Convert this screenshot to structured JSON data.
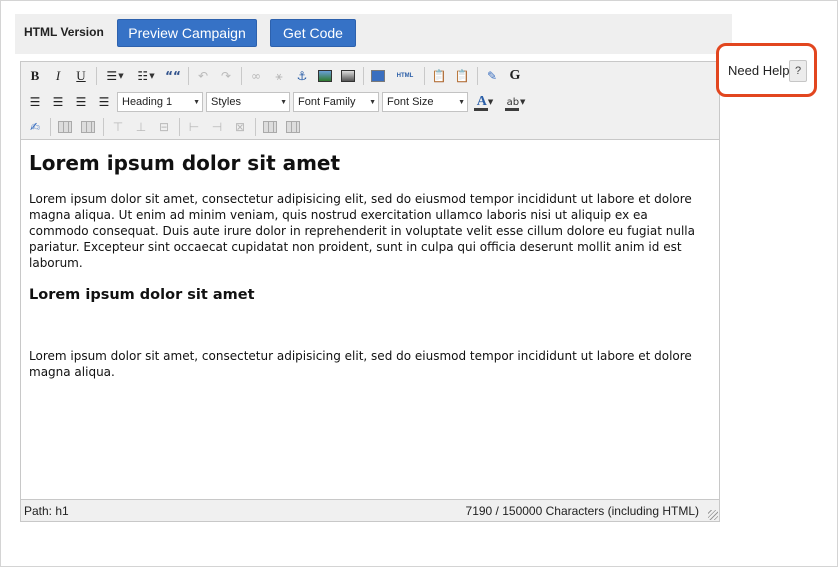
{
  "header": {
    "label": "HTML Version",
    "preview_button": "Preview Campaign",
    "get_code_button": "Get Code"
  },
  "toolbar": {
    "bold": "B",
    "italic": "I",
    "underline": "U",
    "blockquote": "““",
    "html_source": "HTML",
    "google": "G",
    "text_color": "A",
    "highlight": "ab",
    "heading_select": "Heading 1",
    "styles_select": "Styles",
    "font_family_select": "Font Family",
    "font_size_select": "Font Size"
  },
  "content": {
    "heading1": "Lorem ipsum dolor sit amet",
    "paragraph1": "Lorem ipsum dolor sit amet, consectetur adipisicing elit, sed do eiusmod tempor incididunt ut labore et dolore magna aliqua. Ut enim ad minim veniam, quis nostrud exercitation ullamco laboris nisi ut aliquip ex ea commodo consequat. Duis aute irure dolor in reprehenderit in voluptate velit esse cillum dolore eu fugiat nulla pariatur. Excepteur sint occaecat cupidatat non proident, sunt in culpa qui officia deserunt mollit anim id est laborum.",
    "heading2": "Lorem ipsum dolor sit amet",
    "paragraph2": "Lorem ipsum dolor sit amet, consectetur adipisicing elit, sed do eiusmod tempor incididunt ut labore et dolore magna aliqua."
  },
  "status": {
    "path": "Path: h1",
    "char_count": "7190 / 150000 Characters (including HTML)"
  },
  "help": {
    "label": "Need Help",
    "button": "?"
  },
  "colors": {
    "button_blue": "#3672c6",
    "help_border": "#e2461f",
    "header_bg": "#efefef",
    "toolbar_bg": "#f0f0f0"
  },
  "icons": [
    "bold-icon",
    "italic-icon",
    "underline-icon",
    "bullet-list-icon",
    "numbered-list-icon",
    "blockquote-icon",
    "undo-icon",
    "redo-icon",
    "link-icon",
    "unlink-icon",
    "anchor-icon",
    "insert-image-icon",
    "image-icon",
    "preview-icon",
    "html-source-icon",
    "paste-text-icon",
    "paste-word-icon",
    "spellcheck-icon",
    "google-icon",
    "align-left-icon",
    "align-center-icon",
    "align-right-icon",
    "align-justify-icon",
    "text-color-icon",
    "highlight-color-icon",
    "edit-icon",
    "table-icon",
    "resize-grip-icon"
  ]
}
